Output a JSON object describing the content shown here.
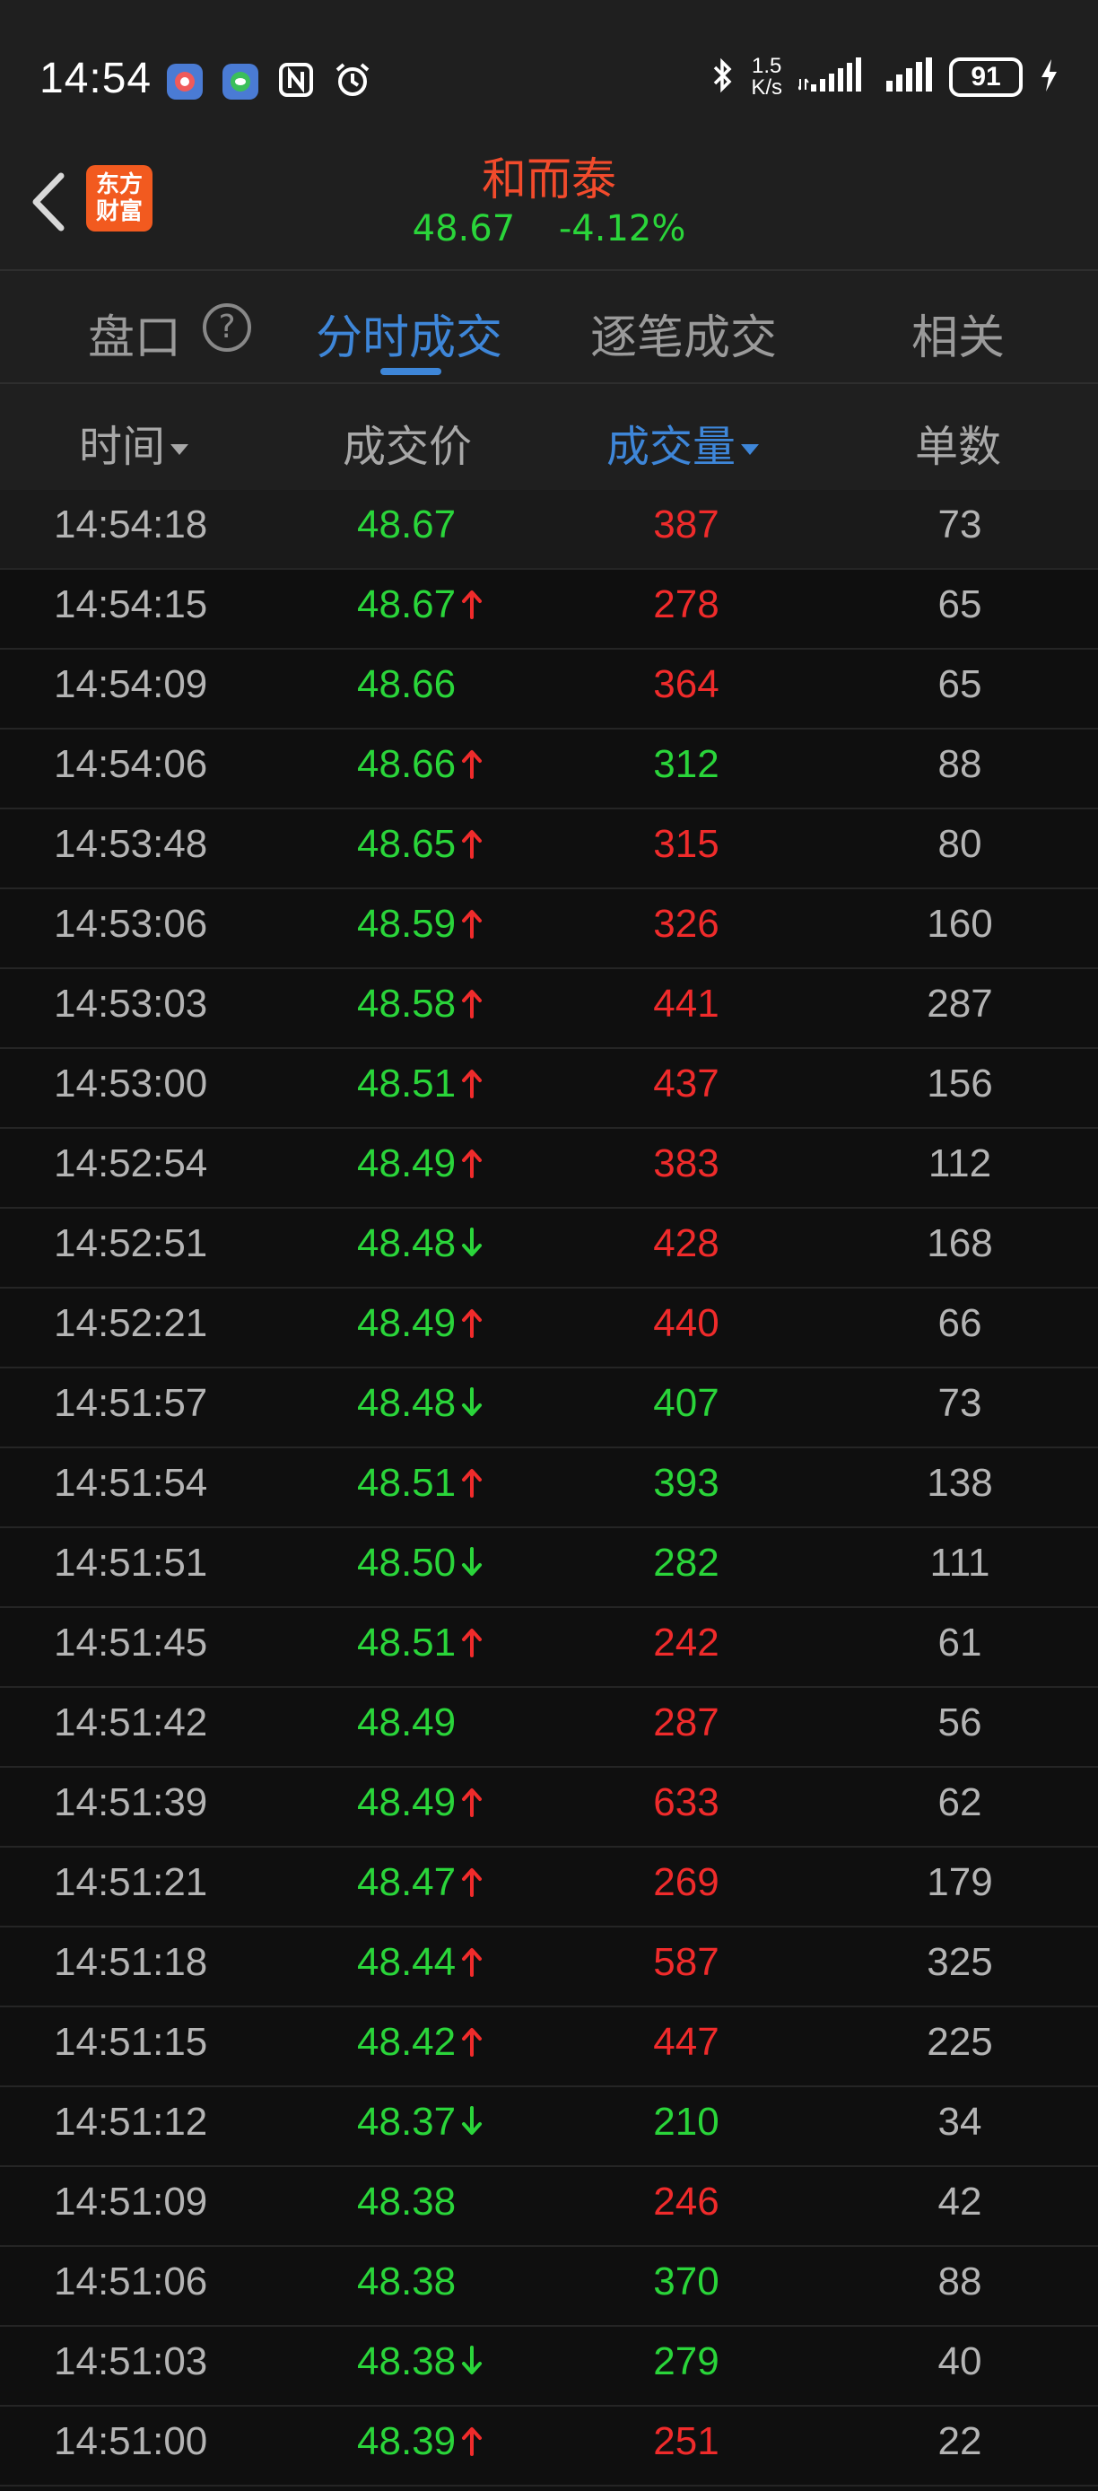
{
  "status_bar": {
    "time": "14:54",
    "speed_value": "1.5",
    "speed_unit": "K/s",
    "battery": "91"
  },
  "header": {
    "logo_line1": "东方",
    "logo_line2": "财富",
    "stock_name": "和而泰",
    "price": "48.67",
    "change_pct": "-4.12%"
  },
  "tabs": [
    {
      "label": "盘口"
    },
    {
      "label": "分时成交"
    },
    {
      "label": "逐笔成交"
    },
    {
      "label": "相关"
    }
  ],
  "columns": {
    "time": "时间",
    "price": "成交价",
    "volume": "成交量",
    "count": "单数"
  },
  "colors": {
    "up_red": "#f02b2b",
    "down_green": "#2ad53a",
    "accent_blue": "#3e86d8",
    "brand_orange": "#f25a1f"
  },
  "trades": [
    {
      "time": "14:54:18",
      "price": "48.67",
      "dir": "none",
      "volume": "387",
      "vol_color": "red",
      "count": "73"
    },
    {
      "time": "14:54:15",
      "price": "48.67",
      "dir": "up",
      "volume": "278",
      "vol_color": "red",
      "count": "65"
    },
    {
      "time": "14:54:09",
      "price": "48.66",
      "dir": "none",
      "volume": "364",
      "vol_color": "red",
      "count": "65"
    },
    {
      "time": "14:54:06",
      "price": "48.66",
      "dir": "up",
      "volume": "312",
      "vol_color": "green",
      "count": "88"
    },
    {
      "time": "14:53:48",
      "price": "48.65",
      "dir": "up",
      "volume": "315",
      "vol_color": "red",
      "count": "80"
    },
    {
      "time": "14:53:06",
      "price": "48.59",
      "dir": "up",
      "volume": "326",
      "vol_color": "red",
      "count": "160"
    },
    {
      "time": "14:53:03",
      "price": "48.58",
      "dir": "up",
      "volume": "441",
      "vol_color": "red",
      "count": "287"
    },
    {
      "time": "14:53:00",
      "price": "48.51",
      "dir": "up",
      "volume": "437",
      "vol_color": "red",
      "count": "156"
    },
    {
      "time": "14:52:54",
      "price": "48.49",
      "dir": "up",
      "volume": "383",
      "vol_color": "red",
      "count": "112"
    },
    {
      "time": "14:52:51",
      "price": "48.48",
      "dir": "down",
      "volume": "428",
      "vol_color": "red",
      "count": "168"
    },
    {
      "time": "14:52:21",
      "price": "48.49",
      "dir": "up",
      "volume": "440",
      "vol_color": "red",
      "count": "66"
    },
    {
      "time": "14:51:57",
      "price": "48.48",
      "dir": "down",
      "volume": "407",
      "vol_color": "green",
      "count": "73"
    },
    {
      "time": "14:51:54",
      "price": "48.51",
      "dir": "up",
      "volume": "393",
      "vol_color": "green",
      "count": "138"
    },
    {
      "time": "14:51:51",
      "price": "48.50",
      "dir": "down",
      "volume": "282",
      "vol_color": "green",
      "count": "111"
    },
    {
      "time": "14:51:45",
      "price": "48.51",
      "dir": "up",
      "volume": "242",
      "vol_color": "red",
      "count": "61"
    },
    {
      "time": "14:51:42",
      "price": "48.49",
      "dir": "none",
      "volume": "287",
      "vol_color": "red",
      "count": "56"
    },
    {
      "time": "14:51:39",
      "price": "48.49",
      "dir": "up",
      "volume": "633",
      "vol_color": "red",
      "count": "62"
    },
    {
      "time": "14:51:21",
      "price": "48.47",
      "dir": "up",
      "volume": "269",
      "vol_color": "red",
      "count": "179"
    },
    {
      "time": "14:51:18",
      "price": "48.44",
      "dir": "up",
      "volume": "587",
      "vol_color": "red",
      "count": "325"
    },
    {
      "time": "14:51:15",
      "price": "48.42",
      "dir": "up",
      "volume": "447",
      "vol_color": "red",
      "count": "225"
    },
    {
      "time": "14:51:12",
      "price": "48.37",
      "dir": "down",
      "volume": "210",
      "vol_color": "green",
      "count": "34"
    },
    {
      "time": "14:51:09",
      "price": "48.38",
      "dir": "none",
      "volume": "246",
      "vol_color": "red",
      "count": "42"
    },
    {
      "time": "14:51:06",
      "price": "48.38",
      "dir": "none",
      "volume": "370",
      "vol_color": "green",
      "count": "88"
    },
    {
      "time": "14:51:03",
      "price": "48.38",
      "dir": "down",
      "volume": "279",
      "vol_color": "green",
      "count": "40"
    },
    {
      "time": "14:51:00",
      "price": "48.39",
      "dir": "up",
      "volume": "251",
      "vol_color": "red",
      "count": "22"
    }
  ]
}
